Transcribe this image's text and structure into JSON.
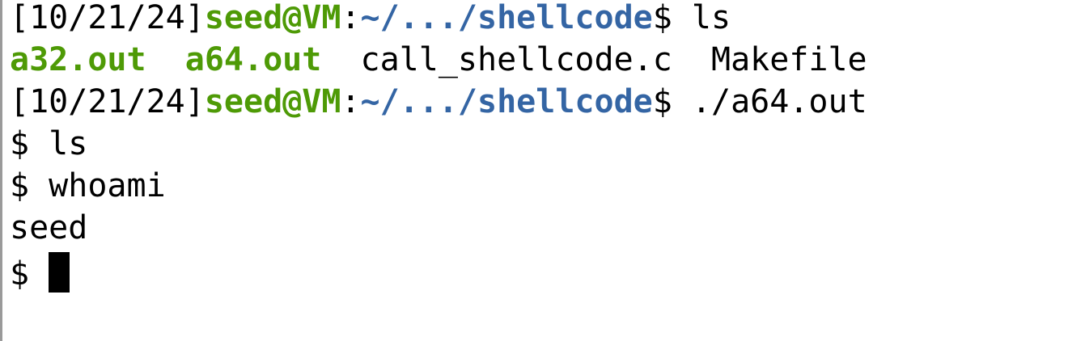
{
  "terminal": {
    "colors": {
      "prompt_user": "#4e9a06",
      "prompt_path": "#3465a4",
      "executable": "#4e9a06",
      "text": "#000000",
      "background": "#ffffff"
    },
    "line1": {
      "date": "[10/21/24]",
      "user": "seed@VM",
      "colon": ":",
      "path": "~/.../shellcode",
      "dollar": "$ ",
      "command": "ls"
    },
    "line2": {
      "file1": "a32.out",
      "file2": "a64.out",
      "file3": "call_shellcode.c",
      "file4": "Makefile"
    },
    "line3": {
      "date": "[10/21/24]",
      "user": "seed@VM",
      "colon": ":",
      "path": "~/.../shellcode",
      "dollar": "$ ",
      "command": "./a64.out"
    },
    "line4": "$ ls",
    "line5": "$ whoami",
    "line6": "seed",
    "line7": "$ "
  }
}
